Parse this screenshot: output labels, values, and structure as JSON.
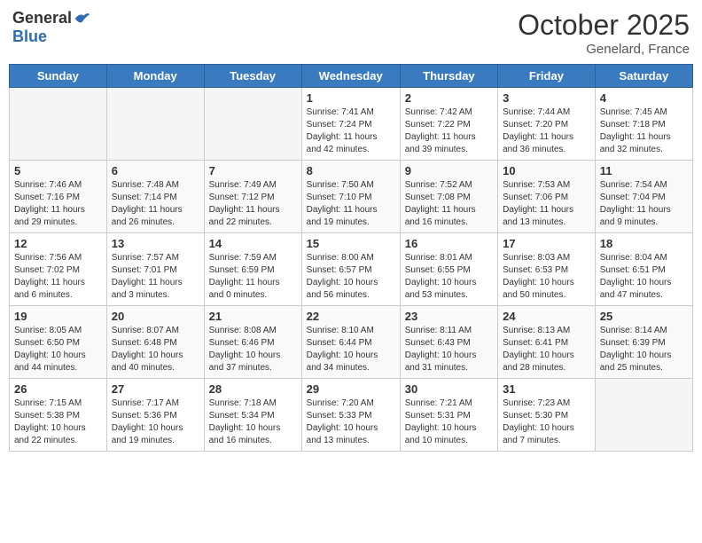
{
  "header": {
    "logo_general": "General",
    "logo_blue": "Blue",
    "month": "October 2025",
    "location": "Genelard, France"
  },
  "days_of_week": [
    "Sunday",
    "Monday",
    "Tuesday",
    "Wednesday",
    "Thursday",
    "Friday",
    "Saturday"
  ],
  "weeks": [
    [
      {
        "day": "",
        "info": ""
      },
      {
        "day": "",
        "info": ""
      },
      {
        "day": "",
        "info": ""
      },
      {
        "day": "1",
        "info": "Sunrise: 7:41 AM\nSunset: 7:24 PM\nDaylight: 11 hours\nand 42 minutes."
      },
      {
        "day": "2",
        "info": "Sunrise: 7:42 AM\nSunset: 7:22 PM\nDaylight: 11 hours\nand 39 minutes."
      },
      {
        "day": "3",
        "info": "Sunrise: 7:44 AM\nSunset: 7:20 PM\nDaylight: 11 hours\nand 36 minutes."
      },
      {
        "day": "4",
        "info": "Sunrise: 7:45 AM\nSunset: 7:18 PM\nDaylight: 11 hours\nand 32 minutes."
      }
    ],
    [
      {
        "day": "5",
        "info": "Sunrise: 7:46 AM\nSunset: 7:16 PM\nDaylight: 11 hours\nand 29 minutes."
      },
      {
        "day": "6",
        "info": "Sunrise: 7:48 AM\nSunset: 7:14 PM\nDaylight: 11 hours\nand 26 minutes."
      },
      {
        "day": "7",
        "info": "Sunrise: 7:49 AM\nSunset: 7:12 PM\nDaylight: 11 hours\nand 22 minutes."
      },
      {
        "day": "8",
        "info": "Sunrise: 7:50 AM\nSunset: 7:10 PM\nDaylight: 11 hours\nand 19 minutes."
      },
      {
        "day": "9",
        "info": "Sunrise: 7:52 AM\nSunset: 7:08 PM\nDaylight: 11 hours\nand 16 minutes."
      },
      {
        "day": "10",
        "info": "Sunrise: 7:53 AM\nSunset: 7:06 PM\nDaylight: 11 hours\nand 13 minutes."
      },
      {
        "day": "11",
        "info": "Sunrise: 7:54 AM\nSunset: 7:04 PM\nDaylight: 11 hours\nand 9 minutes."
      }
    ],
    [
      {
        "day": "12",
        "info": "Sunrise: 7:56 AM\nSunset: 7:02 PM\nDaylight: 11 hours\nand 6 minutes."
      },
      {
        "day": "13",
        "info": "Sunrise: 7:57 AM\nSunset: 7:01 PM\nDaylight: 11 hours\nand 3 minutes."
      },
      {
        "day": "14",
        "info": "Sunrise: 7:59 AM\nSunset: 6:59 PM\nDaylight: 11 hours\nand 0 minutes."
      },
      {
        "day": "15",
        "info": "Sunrise: 8:00 AM\nSunset: 6:57 PM\nDaylight: 10 hours\nand 56 minutes."
      },
      {
        "day": "16",
        "info": "Sunrise: 8:01 AM\nSunset: 6:55 PM\nDaylight: 10 hours\nand 53 minutes."
      },
      {
        "day": "17",
        "info": "Sunrise: 8:03 AM\nSunset: 6:53 PM\nDaylight: 10 hours\nand 50 minutes."
      },
      {
        "day": "18",
        "info": "Sunrise: 8:04 AM\nSunset: 6:51 PM\nDaylight: 10 hours\nand 47 minutes."
      }
    ],
    [
      {
        "day": "19",
        "info": "Sunrise: 8:05 AM\nSunset: 6:50 PM\nDaylight: 10 hours\nand 44 minutes."
      },
      {
        "day": "20",
        "info": "Sunrise: 8:07 AM\nSunset: 6:48 PM\nDaylight: 10 hours\nand 40 minutes."
      },
      {
        "day": "21",
        "info": "Sunrise: 8:08 AM\nSunset: 6:46 PM\nDaylight: 10 hours\nand 37 minutes."
      },
      {
        "day": "22",
        "info": "Sunrise: 8:10 AM\nSunset: 6:44 PM\nDaylight: 10 hours\nand 34 minutes."
      },
      {
        "day": "23",
        "info": "Sunrise: 8:11 AM\nSunset: 6:43 PM\nDaylight: 10 hours\nand 31 minutes."
      },
      {
        "day": "24",
        "info": "Sunrise: 8:13 AM\nSunset: 6:41 PM\nDaylight: 10 hours\nand 28 minutes."
      },
      {
        "day": "25",
        "info": "Sunrise: 8:14 AM\nSunset: 6:39 PM\nDaylight: 10 hours\nand 25 minutes."
      }
    ],
    [
      {
        "day": "26",
        "info": "Sunrise: 7:15 AM\nSunset: 5:38 PM\nDaylight: 10 hours\nand 22 minutes."
      },
      {
        "day": "27",
        "info": "Sunrise: 7:17 AM\nSunset: 5:36 PM\nDaylight: 10 hours\nand 19 minutes."
      },
      {
        "day": "28",
        "info": "Sunrise: 7:18 AM\nSunset: 5:34 PM\nDaylight: 10 hours\nand 16 minutes."
      },
      {
        "day": "29",
        "info": "Sunrise: 7:20 AM\nSunset: 5:33 PM\nDaylight: 10 hours\nand 13 minutes."
      },
      {
        "day": "30",
        "info": "Sunrise: 7:21 AM\nSunset: 5:31 PM\nDaylight: 10 hours\nand 10 minutes."
      },
      {
        "day": "31",
        "info": "Sunrise: 7:23 AM\nSunset: 5:30 PM\nDaylight: 10 hours\nand 7 minutes."
      },
      {
        "day": "",
        "info": ""
      }
    ]
  ]
}
